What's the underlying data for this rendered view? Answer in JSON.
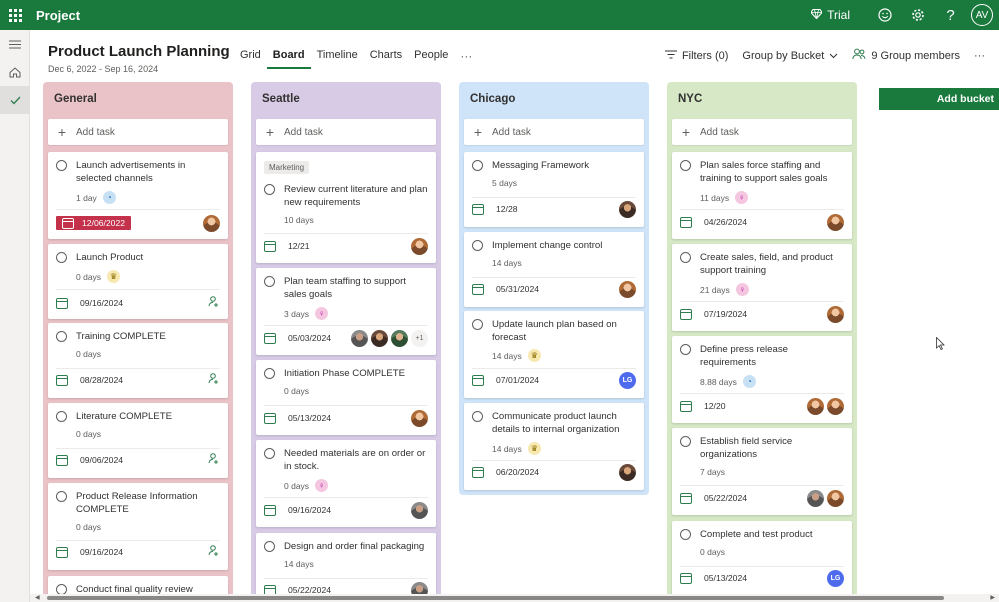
{
  "app": {
    "title": "Project",
    "trial_label": "Trial",
    "user_initials": "AV"
  },
  "plan": {
    "title": "Product Launch Planning",
    "dates": "Dec 6, 2022 - Sep 16, 2024"
  },
  "views": [
    {
      "label": "Grid",
      "active": false
    },
    {
      "label": "Board",
      "active": true
    },
    {
      "label": "Timeline",
      "active": false
    },
    {
      "label": "Charts",
      "active": false
    },
    {
      "label": "People",
      "active": false
    }
  ],
  "toolbar": {
    "filters_label": "Filters (0)",
    "group_label": "Group by Bucket",
    "members_label": "9 Group members"
  },
  "add_task_label": "Add task",
  "add_bucket_label": "Add bucket",
  "colors": {
    "general": "#eac3c8",
    "seattle": "#d7cbe6",
    "chicago": "#cfe4f8",
    "nyc": "#d6e8c6",
    "brand": "#1a7a3e",
    "late": "#c4314b"
  },
  "buckets": [
    {
      "name": "General",
      "cards": [
        {
          "title": "Launch advertisements in selected channels",
          "duration": "1 day",
          "progress": "blue",
          "due": "12/06/2022",
          "late": true
        },
        {
          "title": "Launch Product",
          "duration": "0 days",
          "progress": "gold",
          "due": "09/16/2024"
        },
        {
          "title": "Training COMPLETE",
          "duration": "0 days",
          "due": "08/28/2024"
        },
        {
          "title": "Literature COMPLETE",
          "duration": "0 days",
          "due": "09/06/2024"
        },
        {
          "title": "Product Release Information COMPLETE",
          "duration": "0 days",
          "due": "09/16/2024"
        },
        {
          "title": "Conduct final quality review"
        }
      ]
    },
    {
      "name": "Seattle",
      "cards": [
        {
          "label": "Marketing",
          "title": "Review current literature and plan new requirements",
          "duration": "10 days",
          "due": "12/21"
        },
        {
          "title": "Plan team staffing to support sales goals",
          "duration": "3 days",
          "progress": "pink",
          "due": "05/03/2024",
          "more": "+1"
        },
        {
          "title": "Initiation Phase COMPLETE",
          "duration": "0 days",
          "due": "05/13/2024"
        },
        {
          "title": "Needed materials are on order or in stock.",
          "duration": "0 days",
          "progress": "pink",
          "due": "09/16/2024"
        },
        {
          "title": "Design and order final packaging",
          "duration": "14 days",
          "due": "05/22/2024"
        }
      ]
    },
    {
      "name": "Chicago",
      "cards": [
        {
          "title": "Messaging Framework",
          "duration": "5 days",
          "due": "12/28"
        },
        {
          "title": "Implement change control",
          "duration": "14 days",
          "due": "05/31/2024"
        },
        {
          "title": "Update launch plan based on forecast",
          "duration": "14 days",
          "progress": "gold",
          "due": "07/01/2024",
          "initials": "LG"
        },
        {
          "title": "Communicate product launch details to internal organization",
          "duration": "14 days",
          "progress": "gold",
          "due": "06/20/2024"
        }
      ]
    },
    {
      "name": "NYC",
      "cards": [
        {
          "title": "Plan sales force staffing and training to support sales goals",
          "duration": "11 days",
          "progress": "pink",
          "due": "04/26/2024"
        },
        {
          "title": "Create sales, field, and product support training",
          "duration": "21 days",
          "progress": "pink",
          "due": "07/19/2024"
        },
        {
          "title": "Define press release requirements",
          "duration": "8.88 days",
          "progress": "blue",
          "due": "12/20"
        },
        {
          "title": "Establish field service organizations",
          "duration": "7 days",
          "due": "05/22/2024"
        },
        {
          "title": "Complete and test product",
          "duration": "0 days",
          "due": "05/13/2024",
          "initials": "LG"
        }
      ]
    }
  ]
}
